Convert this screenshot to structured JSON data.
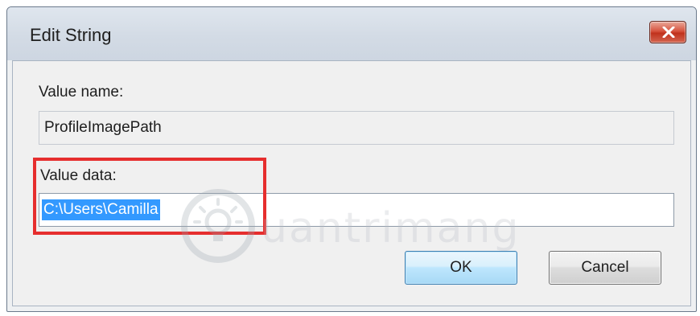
{
  "dialog": {
    "title": "Edit String",
    "close_icon": "close-icon"
  },
  "value_name": {
    "label": "Value name:",
    "value": "ProfileImagePath"
  },
  "value_data": {
    "label": "Value data:",
    "value": "C:\\Users\\Camilla"
  },
  "buttons": {
    "ok_label": "OK",
    "cancel_label": "Cancel"
  },
  "watermark": {
    "text": "uantrimang"
  },
  "colors": {
    "selection": "#3399ff",
    "highlight_box": "#e62e2e",
    "close_button": "#c7432e"
  }
}
